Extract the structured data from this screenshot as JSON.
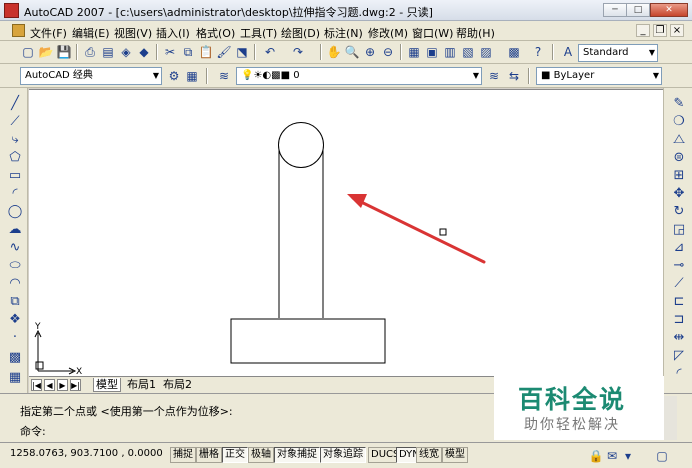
{
  "window": {
    "title": "AutoCAD 2007 - [c:\\users\\administrator\\desktop\\拉伸指令习题.dwg:2 - 只读]",
    "min": "─",
    "max": "□",
    "close": "✕"
  },
  "menu": [
    "文件(F)",
    "编辑(E)",
    "视图(V)",
    "插入(I)",
    "格式(O)",
    "工具(T)",
    "绘图(D)",
    "标注(N)",
    "修改(M)",
    "窗口(W)",
    "帮助(H)"
  ],
  "doc_controls": {
    "min": "_",
    "restore": "❐",
    "close": "×"
  },
  "toolbar": {
    "text_style": "Standard",
    "workspace": "AutoCAD 经典",
    "layer": "0",
    "color": "ByLayer"
  },
  "layout_tabs": [
    "模型",
    "布局1",
    "布局2"
  ],
  "nav_arrows": [
    "|◀",
    "◀",
    "▶",
    "▶|"
  ],
  "ucs": {
    "y": "Y",
    "x": "X"
  },
  "command": {
    "history": "指定第二个点或 <使用第一个点作为位移>:",
    "prompt": "命令:"
  },
  "status": {
    "coords": "1258.0763, 903.7100 , 0.0000",
    "toggles": [
      "捕捉",
      "栅格",
      "正交",
      "极轴",
      "对象捕捉",
      "对象追踪",
      "DUCS",
      "DYN",
      "线宽",
      "模型"
    ]
  },
  "watermark": {
    "title": "百科全说",
    "subtitle": "助你轻松解决"
  },
  "colors": {
    "arrow": "#d93434",
    "watermark": "#1c8a72"
  }
}
